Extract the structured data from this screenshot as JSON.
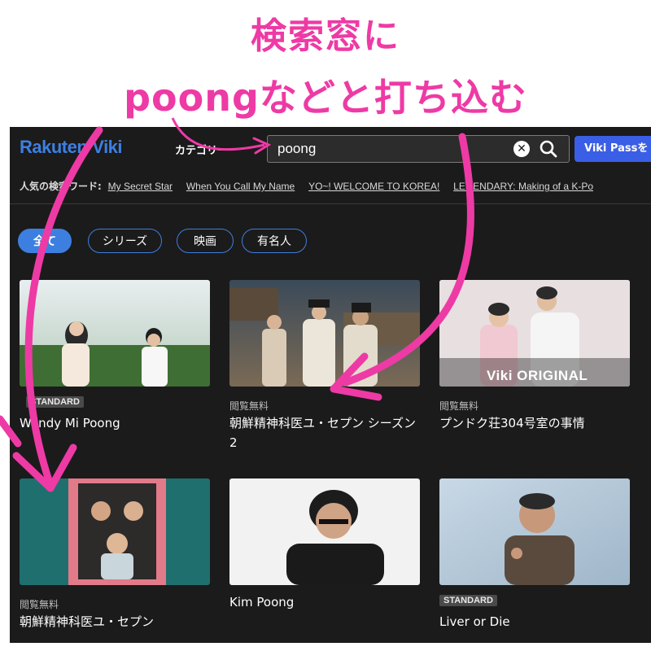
{
  "caption": {
    "line1": "検索窓に",
    "line2": "poongなどと打ち込む"
  },
  "header": {
    "logo_left": "Rakuten",
    "logo_right": "Viki",
    "category_label": "カテゴリー",
    "search_value": "poong",
    "pass_button_label": "Viki Passを"
  },
  "popular": {
    "label": "人気の検索ワード:",
    "items": [
      "My Secret Star",
      "When You Call My Name",
      "YO~! WELCOME TO KOREA!",
      "LEGENDARY: Making of a K-Po"
    ]
  },
  "filters": {
    "all": "全て",
    "series": "シリーズ",
    "movie": "映画",
    "celebrity": "有名人"
  },
  "results": [
    {
      "badge": "STANDARD",
      "title": "Wendy Mi Poong"
    },
    {
      "badge": "閲覧無料",
      "title": "朝鮮精神科医ユ・セプン シーズン2"
    },
    {
      "badge": "閲覧無料",
      "title": "プンドク荘304号室の事情",
      "overlay": "Viki ORIGINAL"
    },
    {
      "badge": "閲覧無料",
      "title": "朝鮮精神科医ユ・セプン"
    },
    {
      "badge": "",
      "title": "Kim Poong"
    },
    {
      "badge": "STANDARD",
      "title": "Liver or Die"
    }
  ],
  "colors": {
    "accent_pink": "#ee3aa5",
    "viki_blue": "#3d7fe0",
    "background": "#1b1b1b"
  }
}
